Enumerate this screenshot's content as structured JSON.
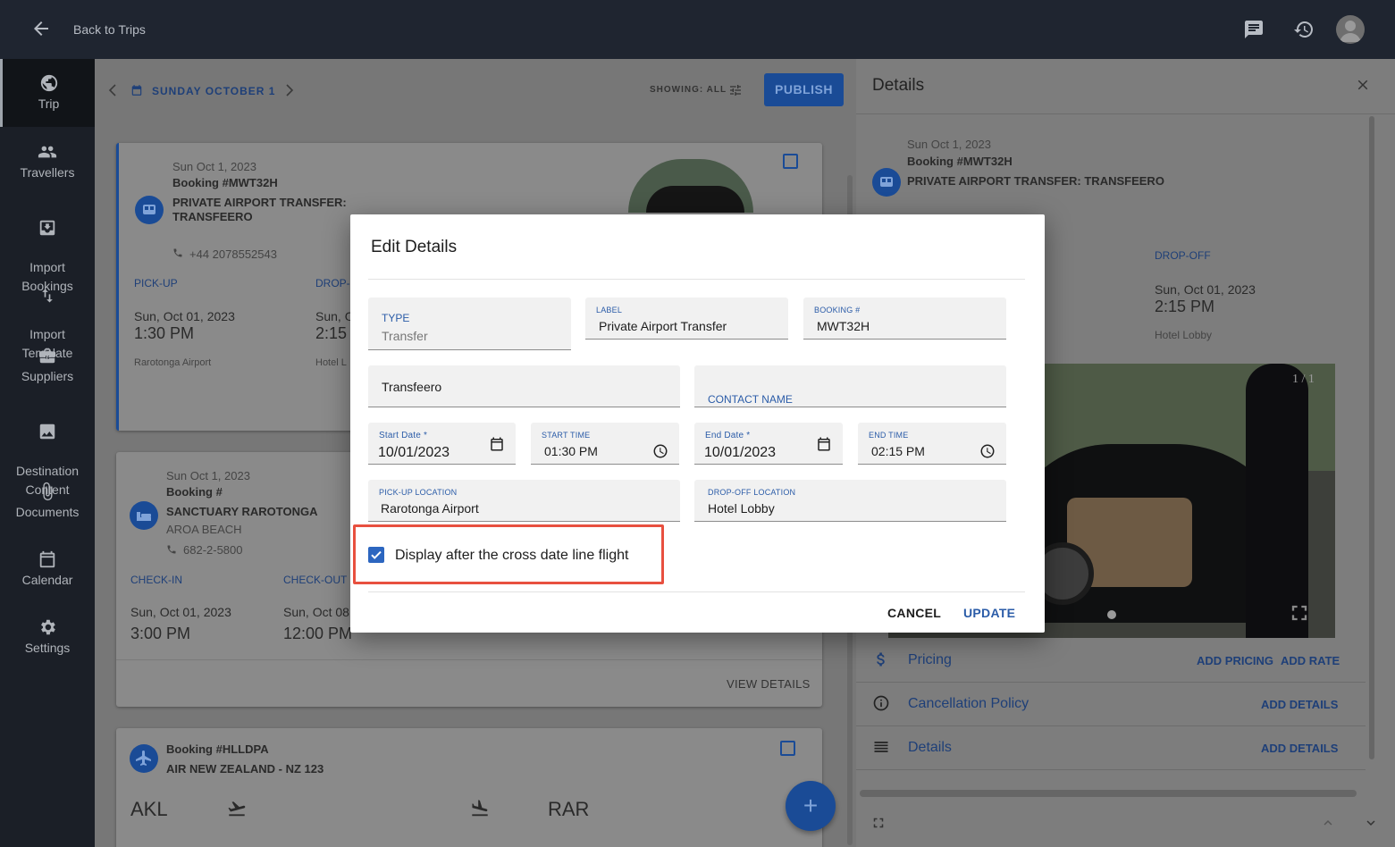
{
  "topbar": {
    "back_label": "Back to Trips"
  },
  "sidebar": {
    "items": [
      {
        "label": "Trip",
        "icon": "globe-icon"
      },
      {
        "label": "Travellers",
        "icon": "people-icon"
      },
      {
        "label": "Import\nBookings",
        "icon": "import-icon"
      },
      {
        "label": "Import\nTemplate",
        "icon": "swap-vertical-icon"
      },
      {
        "label": "Suppliers",
        "icon": "briefcase-icon"
      },
      {
        "label": "Destination\nContent",
        "icon": "image-icon"
      },
      {
        "label": "Documents",
        "icon": "paperclip-icon"
      },
      {
        "label": "Calendar",
        "icon": "calendar-icon"
      },
      {
        "label": "Settings",
        "icon": "gear-icon"
      }
    ]
  },
  "main": {
    "date_label": "SUNDAY OCTOBER 1",
    "showing_label": "SHOWING: ALL",
    "publish_label": "PUBLISH",
    "card1": {
      "date": "Sun Oct 1, 2023",
      "booking": "Booking #MWT32H",
      "title_line1": "PRIVATE AIRPORT TRANSFER:",
      "title_line2": "TRANSFEERO",
      "phone": "+44 2078552543",
      "pickup_label": "PICK-UP",
      "dropoff_label": "DROP-O",
      "pickup_date": "Sun, Oct 01, 2023",
      "pickup_time": "1:30 PM",
      "dropoff_date": "Sun, O",
      "dropoff_time": "2:15",
      "pickup_loc": "Rarotonga Airport",
      "dropoff_loc": "Hotel L"
    },
    "card2": {
      "date": "Sun Oct 1, 2023",
      "booking": "Booking #",
      "title": "SANCTUARY RAROTONGA",
      "subtitle": "AROA BEACH",
      "phone": "682-2-5800",
      "checkin_label": "CHECK-IN",
      "checkout_label": "CHECK-OUT",
      "checkin_date": "Sun, Oct 01, 2023",
      "checkin_time": "3:00 PM",
      "checkout_date": "Sun, Oct 08,",
      "checkout_time": "12:00 PM",
      "view_details": "VIEW DETAILS"
    },
    "card3": {
      "booking": "Booking #HLLDPA",
      "title": "AIR NEW ZEALAND - NZ 123",
      "from": "AKL",
      "to": "RAR"
    },
    "fab_label": "+"
  },
  "details": {
    "title": "Details",
    "date": "Sun Oct 1, 2023",
    "booking": "Booking #MWT32H",
    "transfer_title": "PRIVATE AIRPORT TRANSFER: TRANSFEERO",
    "dropoff_label": "DROP-OFF",
    "dropoff_date": "Sun, Oct 01, 2023",
    "dropoff_time": "2:15 PM",
    "dropoff_loc": "Hotel Lobby",
    "image_counter": "1 / 1",
    "rows": [
      {
        "label": "Pricing",
        "action1": "ADD PRICING",
        "action2": "ADD RATE"
      },
      {
        "label": "Cancellation Policy",
        "action1": "ADD DETAILS"
      },
      {
        "label": "Details",
        "action1": "ADD DETAILS"
      }
    ]
  },
  "modal": {
    "title": "Edit Details",
    "type_label": "TYPE",
    "type_value": "Transfer",
    "label_label": "LABEL",
    "label_value": "Private Airport Transfer",
    "booking_label": "BOOKING #",
    "booking_value": "MWT32H",
    "supplier_value": "Transfeero",
    "contact_placeholder": "CONTACT NAME",
    "start_date_label": "Start Date *",
    "start_date_value": "10/01/2023",
    "start_time_label": "START TIME",
    "start_time_value": "01:30  PM",
    "end_date_label": "End Date *",
    "end_date_value": "10/01/2023",
    "end_time_label": "END TIME",
    "end_time_value": "02:15  PM",
    "pickup_label": "PICK-UP LOCATION",
    "pickup_value": "Rarotonga Airport",
    "dropoff_label": "DROP-OFF LOCATION",
    "dropoff_value": "Hotel Lobby",
    "checkbox_label": "Display after the cross date line flight",
    "checkbox_checked": true,
    "cancel_label": "CANCEL",
    "update_label": "UPDATE"
  },
  "colors": {
    "accent": "#2b5ca8",
    "highlight": "#e8503f"
  }
}
